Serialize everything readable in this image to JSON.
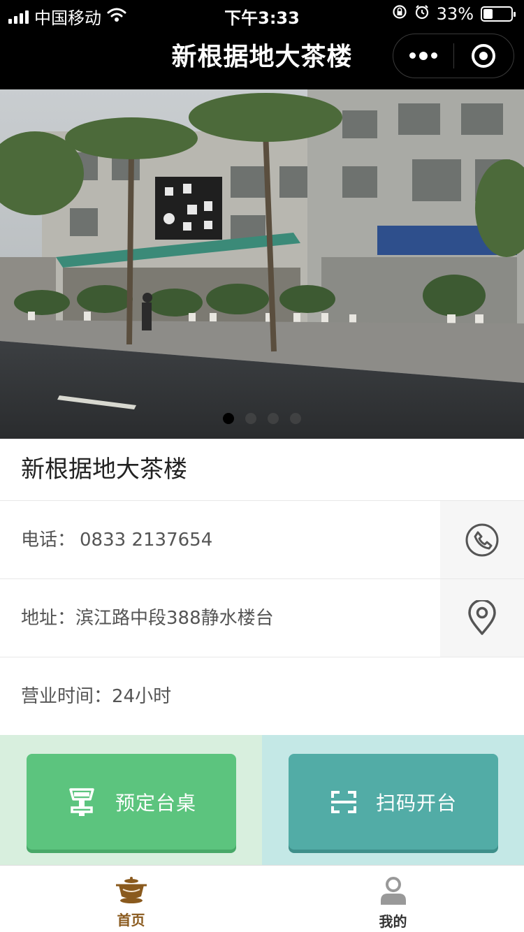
{
  "status_bar": {
    "carrier": "中国移动",
    "time": "下午3:33",
    "battery": "33%"
  },
  "nav": {
    "title": "新根据地大茶楼",
    "more_icon": "more-dots-icon",
    "close_icon": "target-circle-icon"
  },
  "banner": {
    "slide_count": 4,
    "active_index": 0
  },
  "shop": {
    "name": "新根据地大茶楼",
    "phone_label": "电话：",
    "phone_value": "0833 2137654",
    "address_label": "地址：",
    "address_value": "滨江路中段388静水楼台",
    "hours_label": "营业时间：",
    "hours_value": "24小时"
  },
  "actions": {
    "reserve_label": "预定台桌",
    "scan_label": "扫码开台",
    "colors": {
      "green": "#5cc47e",
      "teal": "#52aca6"
    }
  },
  "tabbar": {
    "home_label": "首页",
    "mine_label": "我的",
    "active_color": "#8a5a1e"
  }
}
